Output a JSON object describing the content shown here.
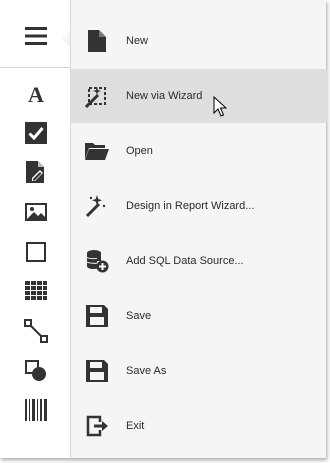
{
  "toolbox": {
    "items": [
      {
        "name": "hamburger-menu-icon"
      },
      {
        "name": "label-icon"
      },
      {
        "name": "checkbox-icon"
      },
      {
        "name": "rich-text-icon"
      },
      {
        "name": "picture-box-icon"
      },
      {
        "name": "panel-icon"
      },
      {
        "name": "table-icon"
      },
      {
        "name": "line-icon"
      },
      {
        "name": "shape-icon"
      },
      {
        "name": "barcode-icon"
      }
    ]
  },
  "menu": {
    "hover_color": "#dedede",
    "background": "#f5f5f5",
    "items": [
      {
        "label": "New",
        "icon": "new-document-icon"
      },
      {
        "label": "New via Wizard",
        "icon": "wizard-wand-icon"
      },
      {
        "label": "Open",
        "icon": "folder-icon"
      },
      {
        "label": "Design in Report Wizard...",
        "icon": "magic-wand-icon"
      },
      {
        "label": "Add SQL Data Source...",
        "icon": "database-add-icon"
      },
      {
        "label": "Save",
        "icon": "save-icon"
      },
      {
        "label": "Save As",
        "icon": "save-as-icon"
      },
      {
        "label": "Exit",
        "icon": "exit-icon"
      }
    ]
  }
}
